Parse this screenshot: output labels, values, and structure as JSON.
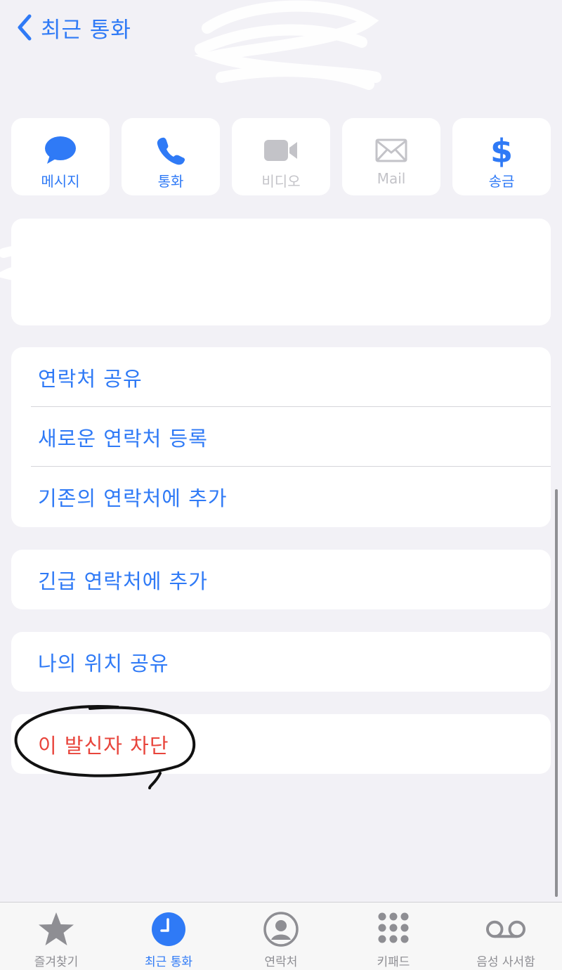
{
  "nav": {
    "back_label": "최근 통화"
  },
  "actions": [
    {
      "label": "메시지",
      "icon": "message-bubble-icon",
      "enabled": true
    },
    {
      "label": "통화",
      "icon": "phone-icon",
      "enabled": true
    },
    {
      "label": "비디오",
      "icon": "video-icon",
      "enabled": false
    },
    {
      "label": "Mail",
      "icon": "mail-icon",
      "enabled": false
    },
    {
      "label": "송금",
      "icon": "dollar-icon",
      "enabled": true
    }
  ],
  "menu": {
    "contact_group": [
      "연락처 공유",
      "새로운 연락처 등록",
      "기존의 연락처에 추가"
    ],
    "emergency": "긴급 연락처에 추가",
    "location": "나의 위치 공유",
    "block": "이 발신자 차단"
  },
  "tabbar": {
    "items": [
      {
        "label": "즐겨찾기",
        "icon": "star-icon",
        "active": false
      },
      {
        "label": "최근 통화",
        "icon": "clock-icon",
        "active": true
      },
      {
        "label": "연락처",
        "icon": "person-circle-icon",
        "active": false
      },
      {
        "label": "키패드",
        "icon": "keypad-icon",
        "active": false
      },
      {
        "label": "음성 사서함",
        "icon": "voicemail-icon",
        "active": false
      }
    ]
  },
  "colors": {
    "accent": "#2f7af6",
    "danger": "#e8453c",
    "background": "#f2f1f6",
    "disabled": "#c3c3c8",
    "tab_inactive": "#8e8e93"
  }
}
